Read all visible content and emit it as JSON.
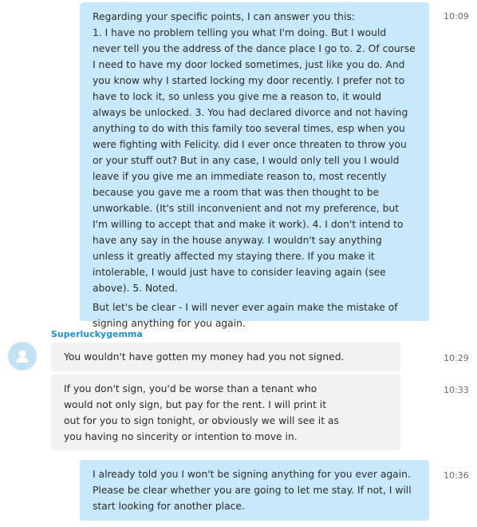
{
  "messages": [
    {
      "paragraphs": [
        "Regarding your specific points, I can answer you this:",
        "1. I have no problem telling you what I'm doing. But I would never tell you the address of the dance place I go to. 2. Of course I need to have my door locked sometimes, just like you do. And you know why I started locking my door recently. I prefer not to have to lock it, so unless you give me a reason to, it would always be unlocked. 3. You had declared divorce and not having anything to do with this family too several times, esp when you were fighting with Felicity. did I ever once threaten to throw you or your stuff out? But in any case, I would only tell you I would leave if you give me an immediate reason to, most recently because you gave me a room that was then thought to be unworkable. (It's still inconvenient and not my preference, but I'm willing to accept that and make it work). 4. I don't intend to have any say in the house anyway. I wouldn't say anything unless it greatly affected my staying there. If you make it intolerable, I would just have to consider leaving again (see above).  5. Noted.",
        "But let's be clear - I will never ever again make the mistake of signing anything for you again."
      ],
      "time": "10:09"
    },
    {
      "sender": "Superluckygemma"
    },
    {
      "text": "You wouldn't have gotten my money had you not signed.",
      "time": "10:29"
    },
    {
      "text": "If you don't sign, you'd be worse than a tenant who would not only sign, but pay for the rent. I will print it out for you to sign tonight, or obviously we will see it as you having no sincerity or intention to move in.",
      "time": "10:33"
    },
    {
      "text": "I already told you I won't be signing anything for you ever again. Please be clear whether you are going to let me stay. If not, I will start looking for another place.",
      "time": "10:36"
    }
  ],
  "icons": {
    "avatar": "person-avatar-icon"
  },
  "colors": {
    "outgoing": "#c7e9fb",
    "incoming": "#f1f2f4",
    "sender": "#1f8fc7",
    "avatar": "#c2e2f4"
  }
}
